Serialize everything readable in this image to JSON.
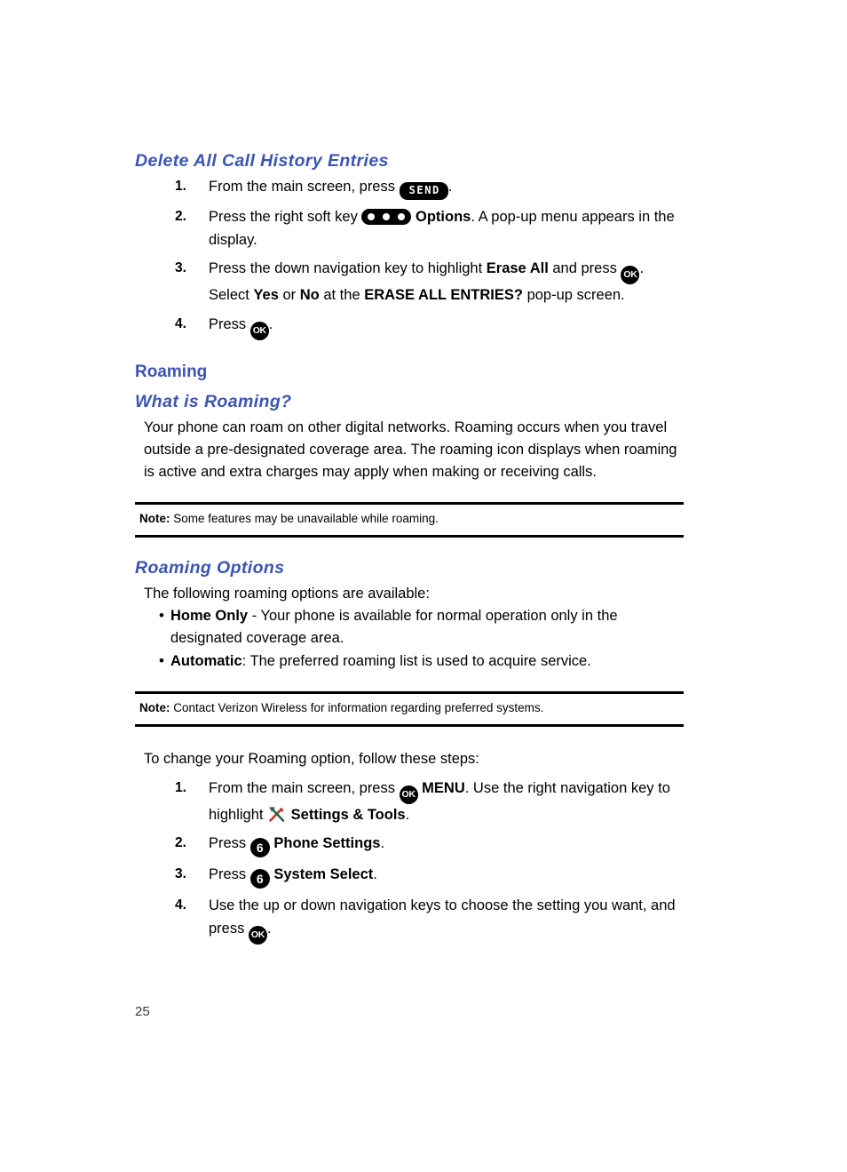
{
  "page": {
    "number": "25",
    "accent_color": "#3c54b2",
    "text_color": "#000000"
  },
  "sections": {
    "delete_all": {
      "heading": "Delete All Call History Entries",
      "steps": [
        {
          "num": "1.",
          "parts": [
            {
              "t": "text",
              "v": "From the main screen, press "
            },
            {
              "t": "icon",
              "v": "send-key-icon",
              "label": "SEND"
            },
            {
              "t": "text",
              "v": "."
            }
          ]
        },
        {
          "num": "2.",
          "parts": [
            {
              "t": "text",
              "v": "Press the right soft key "
            },
            {
              "t": "icon",
              "v": "soft-key-icon",
              "label": ""
            },
            {
              "t": "text",
              "v": " "
            },
            {
              "t": "bold",
              "v": "Options"
            },
            {
              "t": "text",
              "v": ". A pop-up menu appears in the display."
            }
          ]
        },
        {
          "num": "3.",
          "parts": [
            {
              "t": "text",
              "v": "Press the down navigation key to highlight "
            },
            {
              "t": "bold",
              "v": "Erase All"
            },
            {
              "t": "text",
              "v": " and press "
            },
            {
              "t": "icon",
              "v": "ok-key-icon",
              "label": "OK"
            },
            {
              "t": "text",
              "v": ". Select "
            },
            {
              "t": "bold",
              "v": "Yes"
            },
            {
              "t": "text",
              "v": " or "
            },
            {
              "t": "bold",
              "v": "No"
            },
            {
              "t": "text",
              "v": " at the "
            },
            {
              "t": "bold",
              "v": "ERASE ALL ENTRIES?"
            },
            {
              "t": "text",
              "v": " pop-up screen."
            }
          ]
        },
        {
          "num": "4.",
          "parts": [
            {
              "t": "text",
              "v": "Press "
            },
            {
              "t": "icon",
              "v": "ok-key-icon",
              "label": "OK"
            },
            {
              "t": "text",
              "v": "."
            }
          ]
        }
      ]
    },
    "roaming": {
      "heading": "Roaming",
      "what_is": {
        "heading": "What is Roaming?",
        "body": "Your phone can roam on other digital networks. Roaming occurs when you travel outside a pre-designated coverage area. The roaming icon displays when roaming is active and extra charges may apply when making or receiving calls."
      },
      "note_1": {
        "label": "Note:",
        "text": " Some features may be unavailable while roaming."
      },
      "options": {
        "heading": "Roaming Options",
        "intro": "The following roaming options are available:",
        "bullets": [
          {
            "marker": "•",
            "parts": [
              {
                "t": "bold",
                "v": "Home Only"
              },
              {
                "t": "text",
                "v": " - Your phone is available for normal operation only in the designated coverage area."
              }
            ]
          },
          {
            "marker": "•",
            "parts": [
              {
                "t": "bold",
                "v": "Automatic"
              },
              {
                "t": "text",
                "v": ": The preferred roaming list is used to acquire service."
              }
            ]
          }
        ]
      },
      "note_2": {
        "label": "Note:",
        "text": " Contact Verizon Wireless for information regarding preferred systems."
      },
      "change_intro": "To change your Roaming option, follow these steps:",
      "change_steps": [
        {
          "num": "1.",
          "parts": [
            {
              "t": "text",
              "v": "From the main screen, press "
            },
            {
              "t": "icon",
              "v": "ok-key-icon",
              "label": "OK"
            },
            {
              "t": "text",
              "v": " "
            },
            {
              "t": "bold",
              "v": "MENU"
            },
            {
              "t": "text",
              "v": ". Use the right navigation key to highlight "
            },
            {
              "t": "icon",
              "v": "settings-tools-icon",
              "label": ""
            },
            {
              "t": "text",
              "v": " "
            },
            {
              "t": "bold",
              "v": "Settings & Tools"
            },
            {
              "t": "text",
              "v": "."
            }
          ]
        },
        {
          "num": "2.",
          "parts": [
            {
              "t": "text",
              "v": "Press "
            },
            {
              "t": "icon",
              "v": "digit-key-6-icon",
              "label": "6"
            },
            {
              "t": "text",
              "v": " "
            },
            {
              "t": "bold",
              "v": "Phone Settings"
            },
            {
              "t": "text",
              "v": "."
            }
          ]
        },
        {
          "num": "3.",
          "parts": [
            {
              "t": "text",
              "v": "Press "
            },
            {
              "t": "icon",
              "v": "digit-key-6-icon",
              "label": "6"
            },
            {
              "t": "text",
              "v": " "
            },
            {
              "t": "bold",
              "v": "System Select"
            },
            {
              "t": "text",
              "v": "."
            }
          ]
        },
        {
          "num": "4.",
          "parts": [
            {
              "t": "text",
              "v": "Use the up or down navigation keys to choose the setting you want, and press "
            },
            {
              "t": "icon",
              "v": "ok-key-icon",
              "label": "OK"
            },
            {
              "t": "text",
              "v": "."
            }
          ]
        }
      ]
    }
  }
}
